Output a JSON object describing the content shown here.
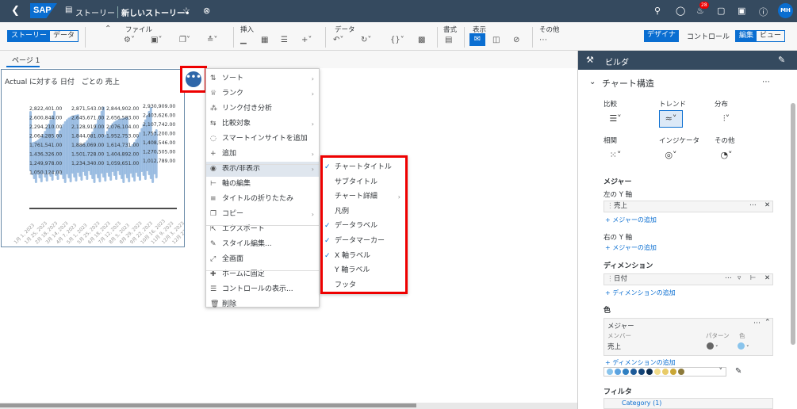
{
  "shell": {
    "logo": "SAP",
    "story_label": "ストーリー",
    "story_name": "新しいストーリー•",
    "notification_count": "28",
    "avatar": "MH"
  },
  "toolbar": {
    "view_modes": [
      "ストーリー",
      "データ"
    ],
    "groups": {
      "file": "ファイル",
      "insert": "挿入",
      "data": "データ",
      "format": "書式",
      "display": "表示",
      "other": "その他"
    },
    "right_modes": {
      "designer": "デザイナ",
      "control": "コントロール",
      "edit": "編集",
      "view": "ビュー"
    }
  },
  "page_tab": "ページ 1",
  "chart": {
    "title": "Actual に対する 日付　ごとの 売上",
    "data_labels": [
      "2,822,401.00",
      "2,871,543.00",
      "2,844,902.00",
      "2,930,909.00",
      "2,600,844.00",
      "2,645,671.00",
      "2,656,583.00",
      "2,403,626.00",
      "2,294,210.00",
      "2,128,919.00",
      "2,076,104.00",
      "2,107,742.00",
      "2,064,285.00",
      "1,844,081.00",
      "1,952,753.00",
      "1,753,200.00",
      "1,761,541.00",
      "1,886,069.00",
      "1,614,731.00",
      "1,408,546.00",
      "1,436,326.00",
      "1,501,728.00",
      "1,404,892.00",
      "1,270,505.00",
      "1,249,978.00",
      "1,234,340.00",
      "1,059,651.00",
      "1,012,789.00",
      "1,050,124.00"
    ],
    "x_labels": [
      "1月 1, 2023",
      "1月 25, 2023",
      "2月 18, 2023",
      "3月 14, 2023",
      "4月 7, 2023",
      "5月 1, 2023",
      "5月 25, 2023",
      "6月 18, 2023",
      "7月 12, 2023",
      "8月 5, 2023",
      "8月 29, 2023",
      "9月 22, 2023",
      "10月 16, 2023",
      "11月 9, 2023",
      "12月 3, 2023",
      "12月 27, 2023"
    ]
  },
  "context_menu": {
    "items": [
      {
        "label": "ソート",
        "icon": "sort-icon",
        "arrow": true
      },
      {
        "label": "ランク",
        "icon": "rank-icon",
        "arrow": true
      },
      {
        "label": "リンク付き分析",
        "icon": "link-analysis-icon",
        "arrow": false
      },
      {
        "label": "比較対象",
        "icon": "compare-icon",
        "arrow": true
      },
      {
        "label": "スマートインサイトを追加",
        "icon": "lightbulb-icon",
        "arrow": false
      },
      {
        "label": "追加",
        "icon": "plus-icon",
        "arrow": true
      },
      {
        "label": "表示/非表示",
        "icon": "eye-icon",
        "arrow": true,
        "selected": true
      },
      {
        "label": "軸の編集",
        "icon": "axis-edit-icon",
        "arrow": false
      },
      {
        "label": "タイトルの折りたたみ",
        "icon": "collapse-icon",
        "arrow": false
      },
      {
        "label": "コピー",
        "icon": "copy-icon",
        "arrow": true
      },
      {
        "label": "エクスポート",
        "icon": "export-icon",
        "arrow": false
      },
      {
        "label": "スタイル編集...",
        "icon": "style-icon",
        "arrow": false
      },
      {
        "label": "全画面",
        "icon": "fullscreen-icon",
        "arrow": false
      },
      {
        "label": "ホームに固定",
        "icon": "pin-icon",
        "arrow": false
      },
      {
        "label": "コントロールの表示...",
        "icon": "controls-icon",
        "arrow": false
      },
      {
        "label": "削除",
        "icon": "trash-icon",
        "arrow": false
      }
    ]
  },
  "submenu": {
    "items": [
      {
        "label": "チャートタイトル",
        "checked": true,
        "arrow": false
      },
      {
        "label": "サブタイトル",
        "checked": false,
        "arrow": false
      },
      {
        "label": "チャート詳細",
        "checked": false,
        "arrow": true
      },
      {
        "label": "凡例",
        "checked": false,
        "arrow": false
      },
      {
        "label": "データラベル",
        "checked": true,
        "arrow": false
      },
      {
        "label": "データマーカー",
        "checked": true,
        "arrow": false
      },
      {
        "label": "X 軸ラベル",
        "checked": true,
        "arrow": false
      },
      {
        "label": "Y 軸ラベル",
        "checked": false,
        "arrow": false
      },
      {
        "label": "フッタ",
        "checked": false,
        "arrow": false
      }
    ]
  },
  "builder": {
    "title": "ビルダ",
    "section": "チャート構造",
    "types": [
      {
        "label": "比較",
        "icon": "bar-chart-icon"
      },
      {
        "label": "トレンド",
        "icon": "trend-chart-icon",
        "selected": true
      },
      {
        "label": "分布",
        "icon": "distribution-icon"
      },
      {
        "label": "相関",
        "icon": "scatter-icon"
      },
      {
        "label": "インジケータ",
        "icon": "bullet-icon"
      },
      {
        "label": "その他",
        "icon": "donut-icon"
      }
    ],
    "measure_head": "メジャー",
    "left_axis": "左の Y 軸",
    "left_measure": "売上",
    "add_measure": "+ メジャーの追加",
    "right_axis": "右の Y 軸",
    "add_measure2": "+ メジャーの追加",
    "dimension_head": "ディメンション",
    "dimension": "日付",
    "add_dimension": "+ ディメンションの追加",
    "color_head": "色",
    "color_box_title": "メジャー",
    "color_member_col": "メンバー",
    "color_pattern_col": "パターン",
    "color_color_col": "色",
    "color_member": "売上",
    "color_add_dimension": "+ ディメンションの追加",
    "palette": [
      "#89c4ec",
      "#5ca3e0",
      "#2f7fc1",
      "#1d5b99",
      "#134477",
      "#0b2b4d",
      "#f2dc8a",
      "#e8cb68",
      "#c9a635",
      "#8c7a3a"
    ],
    "filter_head": "フィルタ",
    "filter_item": "Category (1)"
  }
}
